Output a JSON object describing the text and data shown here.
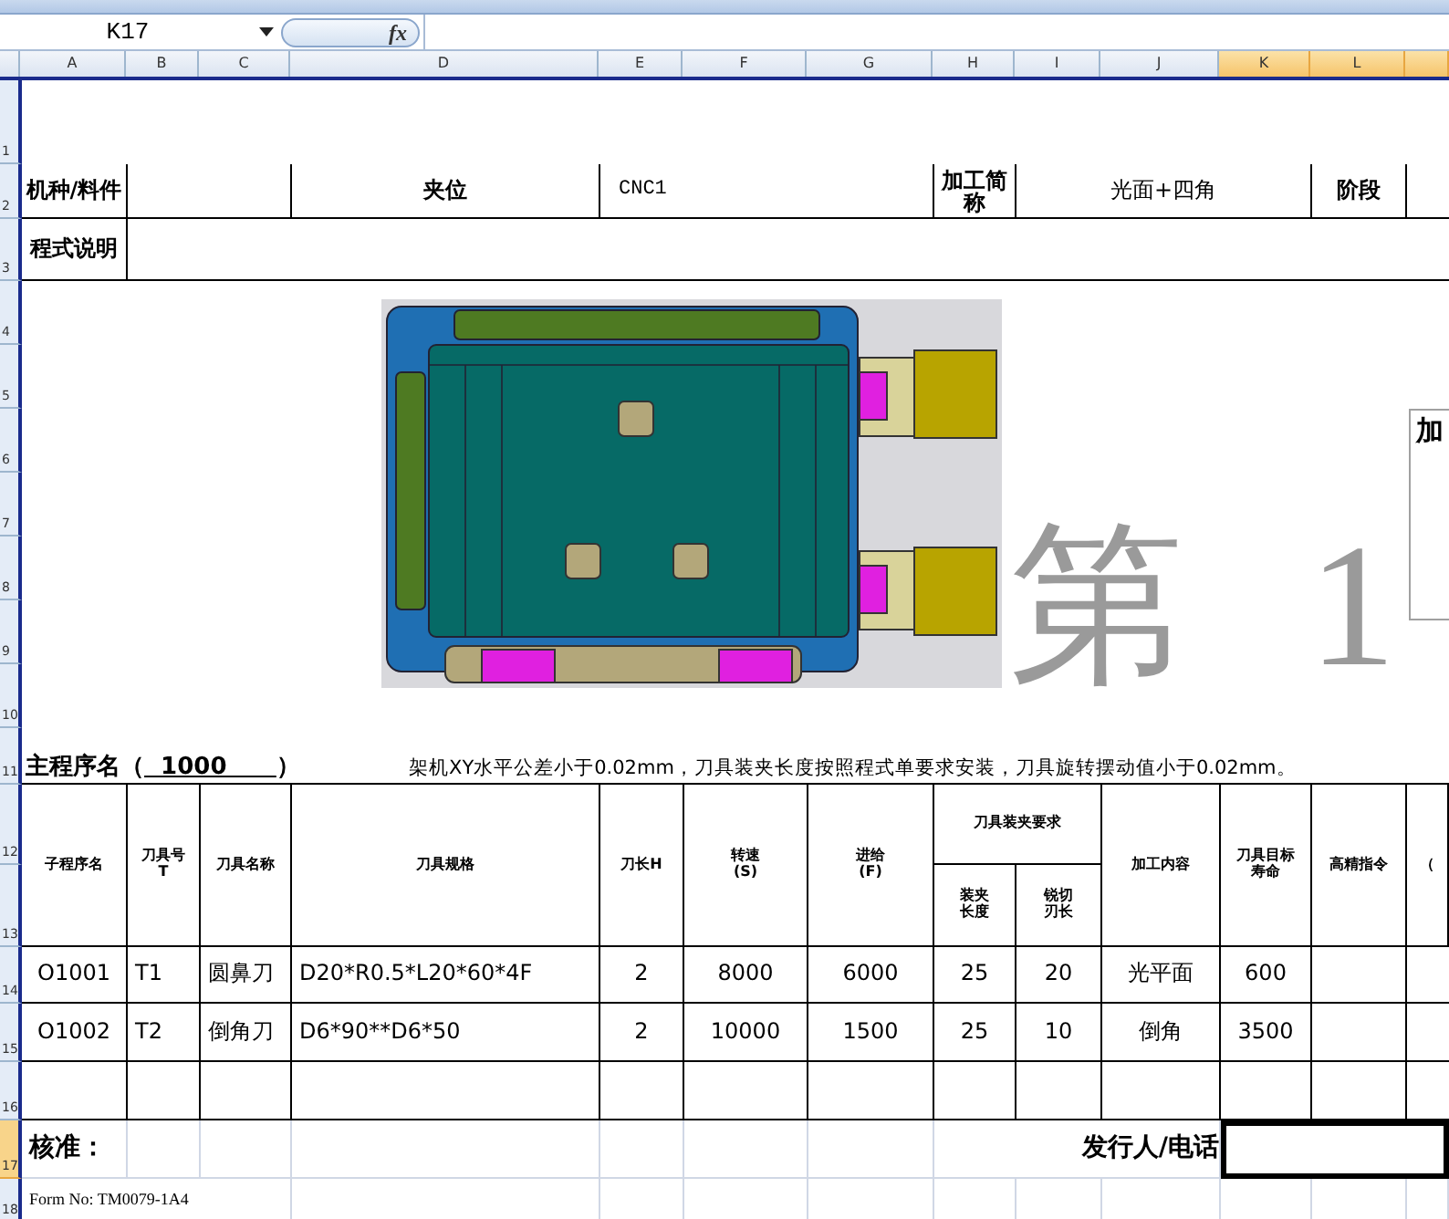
{
  "formula_bar": {
    "name_box": "K17",
    "function_label": "fx"
  },
  "column_headers": [
    {
      "label": "A",
      "selected": false
    },
    {
      "label": "B",
      "selected": false
    },
    {
      "label": "C",
      "selected": false
    },
    {
      "label": "D",
      "selected": false
    },
    {
      "label": "E",
      "selected": false
    },
    {
      "label": "F",
      "selected": false
    },
    {
      "label": "G",
      "selected": false
    },
    {
      "label": "H",
      "selected": false
    },
    {
      "label": "I",
      "selected": false
    },
    {
      "label": "J",
      "selected": false
    },
    {
      "label": "K",
      "selected": true
    },
    {
      "label": "L",
      "selected": true
    },
    {
      "selected": true
    }
  ],
  "row_headers": [
    {
      "label": "1",
      "selected": false
    },
    {
      "label": "2",
      "selected": false
    },
    {
      "label": "3",
      "selected": false
    },
    {
      "label": "4",
      "selected": false
    },
    {
      "label": "5",
      "selected": false
    },
    {
      "label": "6",
      "selected": false
    },
    {
      "label": "7",
      "selected": false
    },
    {
      "label": "8",
      "selected": false
    },
    {
      "label": "9",
      "selected": false
    },
    {
      "label": "10",
      "selected": false
    },
    {
      "label": "11",
      "selected": false
    },
    {
      "label": "12",
      "selected": false
    },
    {
      "label": "13",
      "selected": false
    },
    {
      "label": "14",
      "selected": false
    },
    {
      "label": "15",
      "selected": false
    },
    {
      "label": "16",
      "selected": false
    },
    {
      "label": "17",
      "selected": true
    },
    {
      "label": "18",
      "selected": false
    }
  ],
  "info_row": {
    "machine_label": "机种/料件",
    "fixture_label": "夹位",
    "cnc": "CNC1",
    "process_label": "加工简称",
    "process": "光面+四角",
    "stage_label": "阶段"
  },
  "program_note_label": "程式说明",
  "page_watermark": "第 1",
  "side_popup": {
    "title": "加"
  },
  "main_program": {
    "label": "主程序名（",
    "value": "1000",
    "suffix": "）"
  },
  "note": "架机XY水平公差小于0.02mm，刀具装夹长度按照程式单要求安装，刀具旋转摆动值小于0.02mm。",
  "tool_table": {
    "columns": [
      {
        "label": "子程序名"
      },
      {
        "label": "刀具号\nT"
      },
      {
        "label": "刀具名称"
      },
      {
        "label": "刀具规格"
      },
      {
        "label": "刀长H"
      },
      {
        "label": "转速\n(S)"
      },
      {
        "label": "进给\n(F)"
      },
      {
        "label": "装夹长度",
        "group_start": "刀具装夹要求",
        "grouped": true
      },
      {
        "label": "锐切刃长",
        "grouped": true
      },
      {
        "label": "加工内容"
      },
      {
        "label": "刀具目标寿命"
      },
      {
        "label": "高精指令"
      },
      {
        "label": "（"
      }
    ],
    "rows": [
      [
        "O1001",
        "T1",
        "圆鼻刀",
        "D20*R0.5*L20*60*4F",
        "2",
        "8000",
        "6000",
        "25",
        "20",
        "光平面",
        "600"
      ],
      [
        "O1002",
        "T2",
        "倒角刀",
        "D6*90**D6*50",
        "2",
        "10000",
        "1500",
        "25",
        "10",
        "倒角",
        "3500"
      ]
    ]
  },
  "footer": {
    "approve_label": "核准：",
    "issuer_label": "发行人/电话",
    "form_no": "Form No:  TM0079-1A4"
  }
}
